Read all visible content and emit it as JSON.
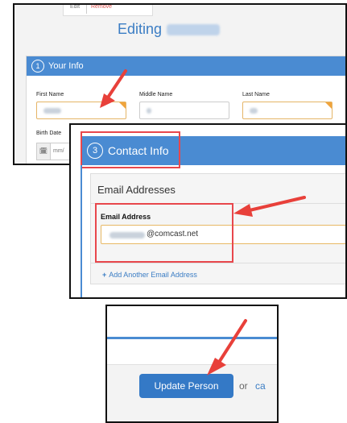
{
  "top_actions": {
    "edit": "Edit",
    "remove": "Remove"
  },
  "editing": {
    "title_prefix": "Editing"
  },
  "your_info": {
    "step": "1",
    "title": "Your Info",
    "first_name_label": "First Name",
    "middle_name_label": "Middle Name",
    "last_name_label": "Last Name",
    "birth_date_label": "Birth Date",
    "birth_date_placeholder": "mm/"
  },
  "contact_info": {
    "step": "3",
    "title": "Contact Info",
    "email_section_title": "Email Addresses",
    "email_label": "Email Address",
    "email_domain": "@comcast.net",
    "add_email_link": "Add Another Email Address",
    "add_icon": "plus-icon"
  },
  "actions": {
    "update_button": "Update Person",
    "or_text": "or",
    "cancel_link": "ca"
  },
  "colors": {
    "header_blue": "#4a8bd2",
    "button_blue": "#3479c6",
    "title_blue": "#3b7dc4",
    "highlight_red": "#e8474c",
    "arrow_red": "#e8403a",
    "warning_orange": "#f0a43c"
  }
}
